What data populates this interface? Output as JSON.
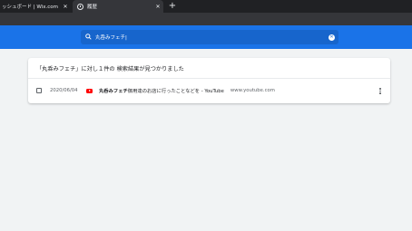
{
  "tabs": [
    {
      "title": "ッシュボード | Wix.com",
      "close": "✕"
    },
    {
      "title": "履歴",
      "close": "✕"
    }
  ],
  "new_tab": "+",
  "search": {
    "query": "丸呑みフェチ|",
    "clear": "✕"
  },
  "results": {
    "summary": "「丸呑みフェチ」に対し１件の 検索結果が見つかりました",
    "items": [
      {
        "date": "2020/06/04",
        "title_bold": "丸呑みフェチ",
        "title_rest": "御用達のお店に行ったことなどを - YouTube",
        "domain": "www.youtube.com"
      }
    ]
  },
  "colors": {
    "header": "#1a73e8",
    "search_bg": "#1765cc",
    "tabstrip": "#202124",
    "youtube": "#ff0000"
  }
}
